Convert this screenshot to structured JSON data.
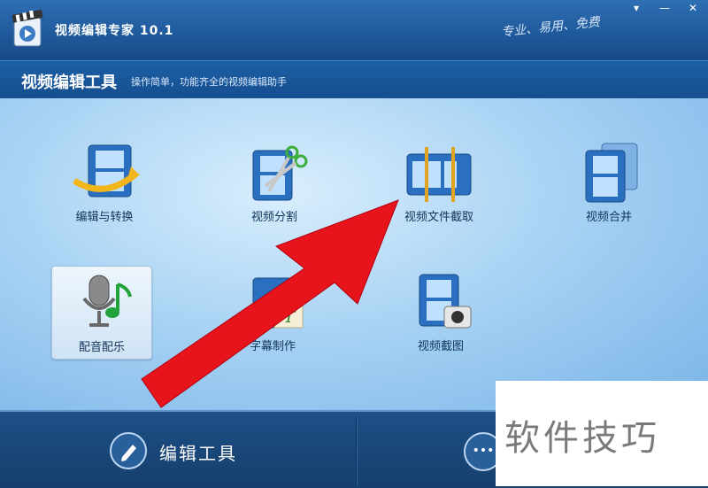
{
  "app": {
    "title": "视频编辑专家 10.1",
    "slogan": "专业、易用、免费"
  },
  "window_controls": [
    {
      "name": "menu-dropdown-icon",
      "glyph": "▾"
    },
    {
      "name": "minimize-icon",
      "glyph": "—"
    },
    {
      "name": "close-icon",
      "glyph": "✕"
    }
  ],
  "header": {
    "title": "视频编辑工具",
    "subtitle": "操作简单，功能齐全的视频编辑助手"
  },
  "tools": [
    {
      "id": "edit-convert",
      "label": "编辑与转换",
      "icon": "film-convert-icon",
      "selected": false
    },
    {
      "id": "split",
      "label": "视频分割",
      "icon": "film-scissors-icon",
      "selected": false
    },
    {
      "id": "clip",
      "label": "视频文件截取",
      "icon": "film-trim-icon",
      "selected": false
    },
    {
      "id": "merge",
      "label": "视频合并",
      "icon": "film-merge-icon",
      "selected": false
    },
    {
      "id": "dub",
      "label": "配音配乐",
      "icon": "microphone-music-icon",
      "selected": true
    },
    {
      "id": "subtitle",
      "label": "字幕制作",
      "icon": "film-subtitle-icon",
      "selected": false
    },
    {
      "id": "screenshot",
      "label": "视频截图",
      "icon": "film-camera-icon",
      "selected": false
    }
  ],
  "bottom_tabs": {
    "edit_label": "编辑工具",
    "more_glyph": "•••"
  },
  "watermark": "软件技巧",
  "colors": {
    "accent_blue": "#1f5a9c",
    "annotation_arrow": "#e8141c"
  }
}
